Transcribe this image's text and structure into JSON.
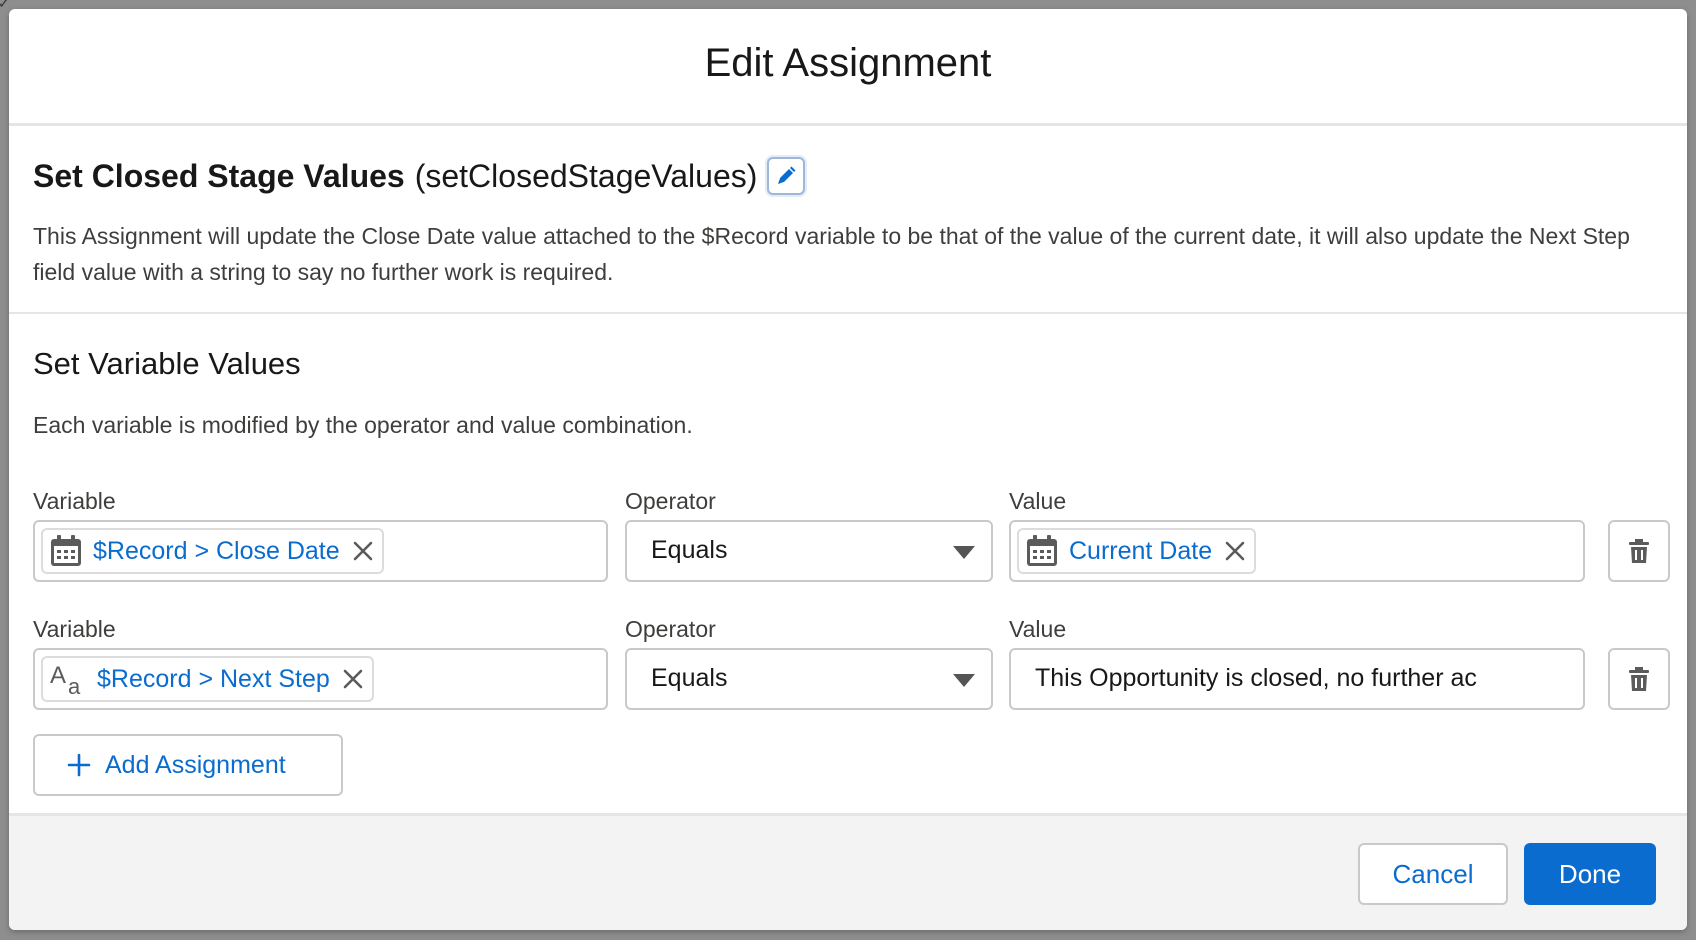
{
  "modal": {
    "title": "Edit Assignment"
  },
  "element": {
    "label": "Set Closed Stage Values",
    "api_name": "(setClosedStageValues)",
    "description": "This Assignment will update the Close Date value attached to the $Record variable to be that of the value of the current date, it will also update the Next Step field value with a string to say no further work is required."
  },
  "variables": {
    "title": "Set Variable Values",
    "description": "Each variable is modified by the operator and value combination.",
    "rows": [
      {
        "variable_label": "Variable",
        "variable_value": "$Record > Close Date",
        "variable_icon": "calendar-icon",
        "operator_label": "Operator",
        "operator_value": "Equals",
        "value_label": "Value",
        "value_value": "Current Date",
        "value_icon": "calendar-icon"
      },
      {
        "variable_label": "Variable",
        "variable_value": "$Record > Next Step",
        "variable_icon": "text-type-icon",
        "operator_label": "Operator",
        "operator_value": "Equals",
        "value_label": "Value",
        "value_value": "This Opportunity is closed, no further ac"
      }
    ],
    "add_label": "Add Assignment"
  },
  "footer": {
    "cancel_label": "Cancel",
    "done_label": "Done"
  },
  "colors": {
    "accent": "#0b6ccf",
    "border": "#c9c9c9",
    "footer_bg": "#f3f3f3"
  }
}
